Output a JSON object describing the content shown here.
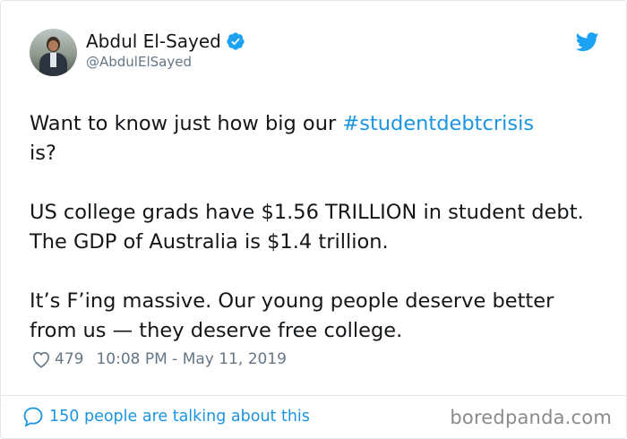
{
  "author": {
    "display_name": "Abdul El-Sayed",
    "handle": "@AbdulElSayed",
    "verified": true,
    "avatar_icon": "profile-photo"
  },
  "tweet": {
    "line1_prefix": "Want to know just how big our ",
    "hashtag": "#studentdebtcrisis",
    "line1_suffix": "is?",
    "paragraph2": "US college grads have $1.56 TRILLION in student debt. The GDP of Australia is $1.4 trillion.",
    "paragraph3": "It’s F’ing massive. Our young people deserve better from us — they deserve free college."
  },
  "meta": {
    "likes": "479",
    "timestamp": "10:08 PM - May 11, 2019"
  },
  "footer": {
    "talking_text": "150 people are talking about this",
    "watermark": "boredpanda.com"
  },
  "colors": {
    "link_blue": "#1b95e0",
    "muted_gray": "#657786",
    "border": "#e1e8ed"
  },
  "icons": [
    "verified-badge-icon",
    "twitter-bird-icon",
    "heart-icon",
    "speech-bubble-icon"
  ]
}
